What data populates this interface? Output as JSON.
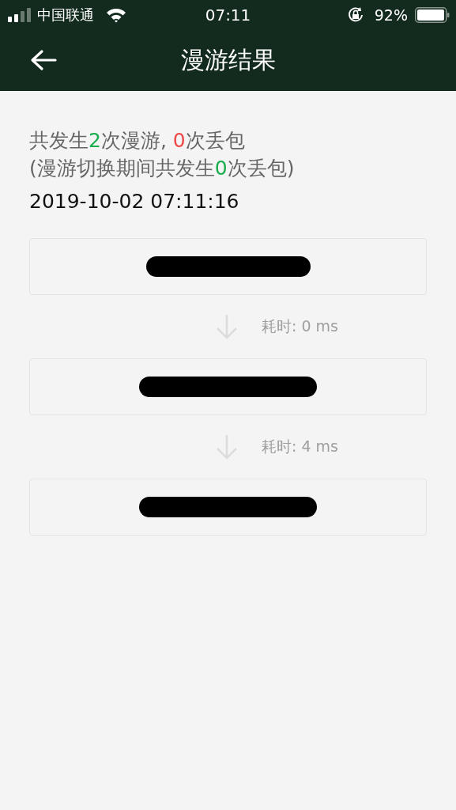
{
  "status_bar": {
    "carrier": "中国联通",
    "time": "07:11",
    "battery": "92%"
  },
  "nav": {
    "title": "漫游结果"
  },
  "summary": [
    [
      {
        "text": "共发生",
        "color": "#666666"
      },
      {
        "text": "2",
        "color": "#1aad4b"
      },
      {
        "text": "次漫游, ",
        "color": "#666666"
      },
      {
        "text": "0",
        "color": "#f04848"
      },
      {
        "text": "次丢包",
        "color": "#666666"
      }
    ],
    [
      {
        "text": "(漫游切换期间共发生",
        "color": "#666666"
      },
      {
        "text": "0",
        "color": "#1aad4b"
      },
      {
        "text": "次丢包)",
        "color": "#666666"
      }
    ]
  ],
  "timestamp": "2019-10-02 07:11:16",
  "steps": [
    {
      "redacted": true
    },
    {
      "redacted": true,
      "duration": "耗时: 0 ms"
    },
    {
      "redacted": true,
      "duration": "耗时: 4 ms"
    }
  ]
}
